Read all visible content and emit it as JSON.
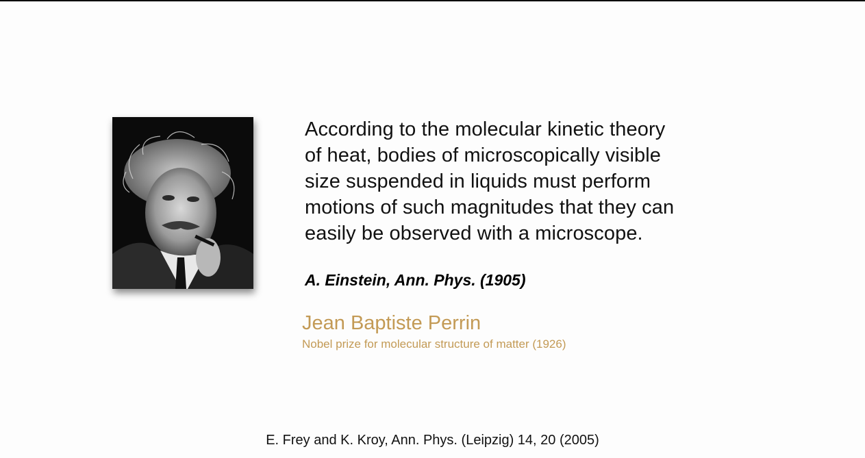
{
  "slide": {
    "quote": "According to the molecular kinetic theory\nof heat, bodies of microscopically visible\nsize suspended in liquids must perform\nmotions of such magnitudes that they can\neasily be observed with a microscope.",
    "attribution": "A. Einstein, Ann. Phys. (1905)",
    "perrin_name": "Jean Baptiste Perrin",
    "perrin_note": "Nobel prize for molecular structure of matter (1926)",
    "reference": "E. Frey and K. Kroy, Ann. Phys. (Leipzig) 14, 20 (2005)"
  },
  "portrait": {
    "subject": "black-and-white portrait photograph",
    "accent_color": "#c39a55"
  }
}
